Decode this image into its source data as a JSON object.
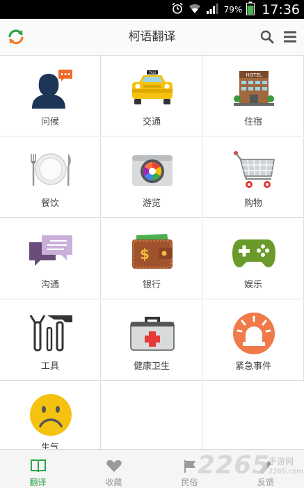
{
  "status_bar": {
    "battery_percent": "79%",
    "time": "17:36",
    "icons": [
      "alarm-icon",
      "wifi-icon",
      "signal-icon",
      "battery-icon"
    ]
  },
  "app_bar": {
    "title": "柯语翻译",
    "logo_icon": "refresh-logo-icon",
    "search_icon": "search-icon",
    "menu_icon": "menu-icon"
  },
  "categories": [
    {
      "label": "问候",
      "icon": "greeting-person-icon"
    },
    {
      "label": "交通",
      "icon": "taxi-icon"
    },
    {
      "label": "住宿",
      "icon": "hotel-icon"
    },
    {
      "label": "餐饮",
      "icon": "dining-plate-icon"
    },
    {
      "label": "游览",
      "icon": "camera-icon"
    },
    {
      "label": "购物",
      "icon": "shopping-cart-icon"
    },
    {
      "label": "沟通",
      "icon": "chat-bubbles-icon"
    },
    {
      "label": "银行",
      "icon": "wallet-icon"
    },
    {
      "label": "娱乐",
      "icon": "gamepad-icon"
    },
    {
      "label": "工具",
      "icon": "tools-icon"
    },
    {
      "label": "健康卫生",
      "icon": "first-aid-kit-icon"
    },
    {
      "label": "紧急事件",
      "icon": "emergency-siren-icon"
    },
    {
      "label": "生气",
      "icon": "sad-face-icon"
    }
  ],
  "bottom_nav": [
    {
      "label": "翻译",
      "icon": "book-icon",
      "active": true
    },
    {
      "label": "收藏",
      "icon": "heart-icon",
      "active": false
    },
    {
      "label": "民俗",
      "icon": "flag-icon",
      "active": false
    },
    {
      "label": "反馈",
      "icon": "feedback-icon",
      "active": false
    }
  ],
  "colors": {
    "accent_green": "#2da44a",
    "status_bar": "#000000",
    "app_bar": "#fafafa"
  },
  "watermark": {
    "number": "2265",
    "label": "手游网",
    "url": "2265.com"
  }
}
